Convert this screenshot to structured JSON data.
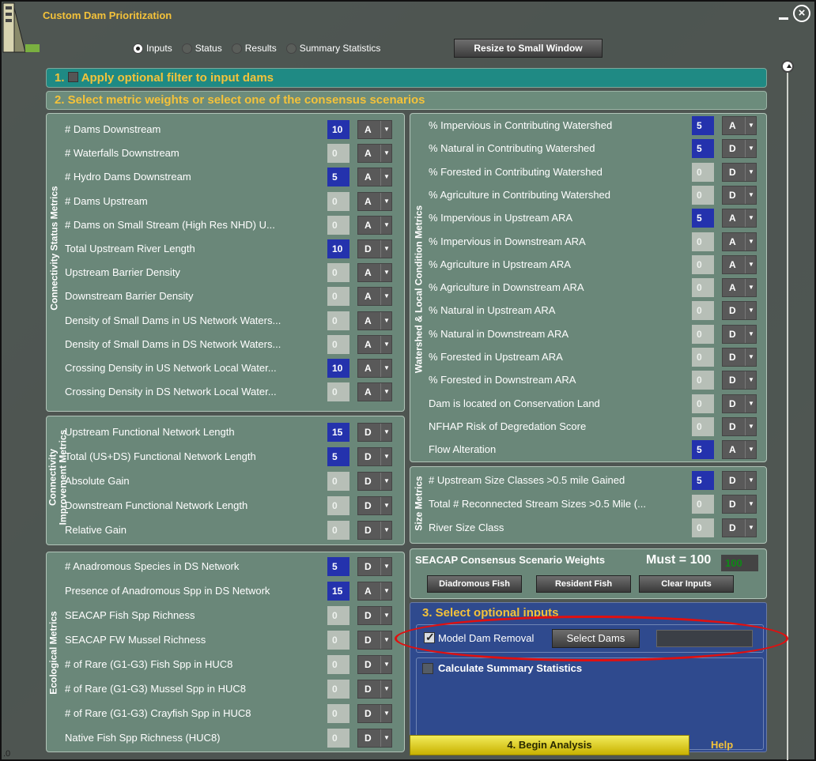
{
  "window": {
    "title": "Custom Dam Prioritization",
    "minimize_icon": "minimize-icon",
    "close_icon": "close-circle-icon"
  },
  "tabs": [
    {
      "label": "Inputs",
      "selected": true
    },
    {
      "label": "Status",
      "selected": false
    },
    {
      "label": "Results",
      "selected": false
    },
    {
      "label": "Summary Statistics",
      "selected": false
    }
  ],
  "resize_button": "Resize to Small Window",
  "section1": {
    "number": "1.",
    "label": "Apply optional filter to input dams",
    "checked": false
  },
  "section2": {
    "label": "2.  Select metric weights or select one of the consensus scenarios"
  },
  "connectivity_status": {
    "title": "Connectivity Status Metrics",
    "rows": [
      {
        "label": "# Dams Downstream",
        "weight": "10",
        "dir": "A"
      },
      {
        "label": "# Waterfalls Downstream",
        "weight": "0",
        "dir": "A"
      },
      {
        "label": "# Hydro Dams Downstream",
        "weight": "5",
        "dir": "A"
      },
      {
        "label": "# Dams Upstream",
        "weight": "0",
        "dir": "A"
      },
      {
        "label": " # Dams on Small Stream (High Res NHD) U...",
        "weight": "0",
        "dir": "A"
      },
      {
        "label": "Total Upstream River Length",
        "weight": "10",
        "dir": "D"
      },
      {
        "label": "Upstream Barrier Density",
        "weight": "0",
        "dir": "A"
      },
      {
        "label": "Downstream Barrier Density",
        "weight": "0",
        "dir": "A"
      },
      {
        "label": "Density of Small Dams in US Network Waters...",
        "weight": "0",
        "dir": "A"
      },
      {
        "label": "Density of Small Dams in DS Network Waters...",
        "weight": "0",
        "dir": "A"
      },
      {
        "label": " Crossing Density in US Network Local Water...",
        "weight": "10",
        "dir": "A"
      },
      {
        "label": " Crossing Density in DS Network Local Water...",
        "weight": "0",
        "dir": "A"
      }
    ]
  },
  "connectivity_improvement": {
    "title1": "Connectivity",
    "title2": "Improvement Metrics",
    "rows": [
      {
        "label": "Upstream Functional Network Length",
        "weight": "15",
        "dir": "D"
      },
      {
        "label": "Total (US+DS) Functional Network Length",
        "weight": "5",
        "dir": "D"
      },
      {
        "label": "Absolute Gain",
        "weight": "0",
        "dir": "D"
      },
      {
        "label": " Downstream Functional Network Length",
        "weight": "0",
        "dir": "D"
      },
      {
        "label": "Relative Gain",
        "weight": "0",
        "dir": "D"
      }
    ]
  },
  "ecological": {
    "title": "Ecological Metrics",
    "rows": [
      {
        "label": "# Anadromous Species in DS Network",
        "weight": "5",
        "dir": "D"
      },
      {
        "label": "Presence of Anadromous Spp in DS Network",
        "weight": "15",
        "dir": "A"
      },
      {
        "label": "SEACAP Fish Spp Richness",
        "weight": "0",
        "dir": "D"
      },
      {
        "label": "SEACAP FW Mussel Richness",
        "weight": "0",
        "dir": "D"
      },
      {
        "label": "# of Rare (G1-G3) Fish Spp in HUC8",
        "weight": "0",
        "dir": "D"
      },
      {
        "label": "# of Rare (G1-G3) Mussel Spp in HUC8",
        "weight": "0",
        "dir": "D"
      },
      {
        "label": "# of Rare (G1-G3) Crayfish Spp in HUC8",
        "weight": "0",
        "dir": "D"
      },
      {
        "label": "Native Fish Spp Richness (HUC8)",
        "weight": "0",
        "dir": "D"
      }
    ]
  },
  "watershed": {
    "title": "Watershed & Local Condition Metrics",
    "rows": [
      {
        "label": "% Impervious in Contributing Watershed",
        "weight": "5",
        "dir": "A"
      },
      {
        "label": "% Natural in Contributing Watershed",
        "weight": "5",
        "dir": "D"
      },
      {
        "label": "% Forested in Contributing Watershed",
        "weight": "0",
        "dir": "D"
      },
      {
        "label": "% Agriculture in Contributing Watershed",
        "weight": "0",
        "dir": "D"
      },
      {
        "label": "% Impervious in Upstream ARA",
        "weight": "5",
        "dir": "A"
      },
      {
        "label": "% Impervious in Downstream ARA",
        "weight": "0",
        "dir": "A"
      },
      {
        "label": "% Agriculture in Upstream ARA",
        "weight": "0",
        "dir": "A"
      },
      {
        "label": "% Agriculture in Downstream ARA",
        "weight": "0",
        "dir": "A"
      },
      {
        "label": "% Natural in Upstream ARA",
        "weight": "0",
        "dir": "D"
      },
      {
        "label": "% Natural in Downstream ARA",
        "weight": "0",
        "dir": "D"
      },
      {
        "label": "% Forested in Upstream ARA",
        "weight": "0",
        "dir": "D"
      },
      {
        "label": "% Forested in Downstream ARA",
        "weight": "0",
        "dir": "D"
      },
      {
        "label": "Dam is located on Conservation Land",
        "weight": "0",
        "dir": "D"
      },
      {
        "label": "NFHAP Risk of Degredation Score",
        "weight": "0",
        "dir": "D"
      },
      {
        "label": "Flow Alteration",
        "weight": "5",
        "dir": "A"
      }
    ]
  },
  "size": {
    "title": "Size Metrics",
    "rows": [
      {
        "label": "# Upstream Size Classes >0.5 mile Gained",
        "weight": "5",
        "dir": "D"
      },
      {
        "label": "Total # Reconnected Stream Sizes >0.5 Mile (...",
        "weight": "0",
        "dir": "D"
      },
      {
        "label": "River Size Class",
        "weight": "0",
        "dir": "D"
      }
    ]
  },
  "consensus": {
    "label": "SEACAP Consensus  Scenario Weights",
    "must_label": "Must = 100",
    "must_value": "100",
    "buttons": [
      "Diadromous Fish",
      "Resident Fish",
      "Clear Inputs"
    ]
  },
  "section3": {
    "title": "3.  Select optional inputs",
    "model_dam_removal": {
      "label": "Model Dam Removal",
      "checked": true
    },
    "select_dams_button": "Select Dams",
    "dams_value": "",
    "calc_summary": {
      "label": "Calculate Summary Statistics",
      "checked": false
    }
  },
  "begin_button": "4. Begin Analysis",
  "help_link": "Help",
  "map_fragment": ".0"
}
